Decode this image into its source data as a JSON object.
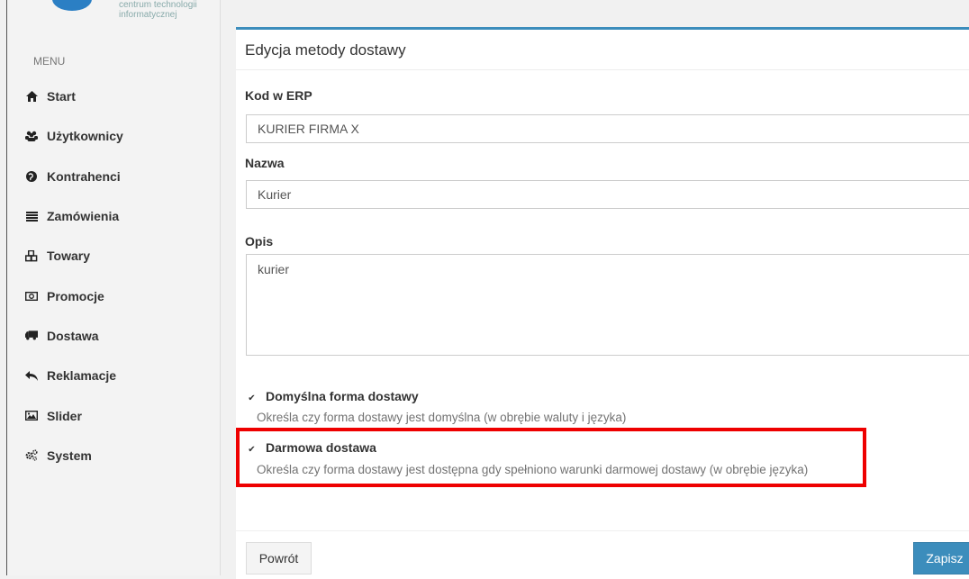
{
  "logo": {
    "line1": "centrum technologii",
    "line2": "informatycznej"
  },
  "sidebar": {
    "menu_label": "MENU",
    "items": [
      {
        "label": "Start",
        "icon": "home-icon"
      },
      {
        "label": "Użytkownicy",
        "icon": "users-icon"
      },
      {
        "label": "Kontrahenci",
        "icon": "globe-icon"
      },
      {
        "label": "Zamówienia",
        "icon": "list-icon"
      },
      {
        "label": "Towary",
        "icon": "cubes-icon"
      },
      {
        "label": "Promocje",
        "icon": "money-icon"
      },
      {
        "label": "Dostawa",
        "icon": "truck-icon"
      },
      {
        "label": "Reklamacje",
        "icon": "reply-icon"
      },
      {
        "label": "Slider",
        "icon": "image-icon"
      },
      {
        "label": "System",
        "icon": "gears-icon"
      }
    ]
  },
  "form": {
    "title": "Edycja metody dostawy",
    "erp_label": "Kod w ERP",
    "erp_value": "KURIER FIRMA X",
    "name_label": "Nazwa",
    "name_value": "Kurier",
    "desc_label": "Opis",
    "desc_value": "kurier",
    "default_label": "Domyślna forma dostawy",
    "default_checked": true,
    "default_help": "Określa czy forma dostawy jest domyślna (w obrębie waluty i języka)",
    "free_label": "Darmowa dostawa",
    "free_checked": true,
    "free_help": "Określa czy forma dostawy jest dostępna gdy spełniono warunki darmowej dostawy (w obrębie języka)",
    "back_label": "Powrót",
    "save_label": "Zapisz"
  },
  "colors": {
    "accent": "#3c8dbc",
    "highlight": "#ee0000"
  }
}
